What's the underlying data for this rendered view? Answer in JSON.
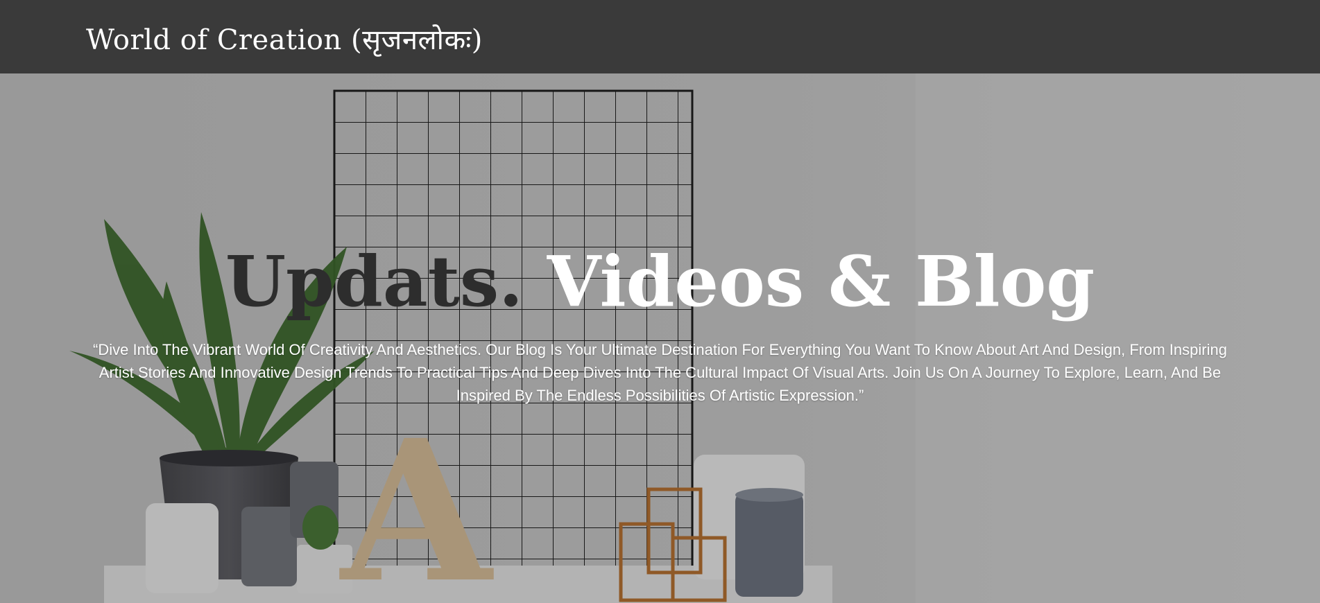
{
  "navbar": {
    "brand": "World of Creation (सृजनलोकः)"
  },
  "hero": {
    "title_part1": "Updats. ",
    "title_part2": "Videos & Blog",
    "description": "“Dive Into The Vibrant World Of Creativity And Aesthetics. Our Blog Is Your Ultimate Destination For Everything You Want To Know About Art And Design, From Inspiring Artist Stories And Innovative Design Trends To Practical Tips And Deep Dives Into The Cultural Impact Of Visual Arts. Join Us On A Journey To Explore, Learn, And Be Inspired By The Endless Possibilities Of Artistic Expression.”",
    "background_image": "workspace-shelf-with-grid-plant-letter-A-candles",
    "letter_decor": "A"
  },
  "colors": {
    "navbar": "#3a3a3a",
    "title_dark": "#2d2d2d",
    "title_light": "#ffffff",
    "text": "#ffffff"
  }
}
